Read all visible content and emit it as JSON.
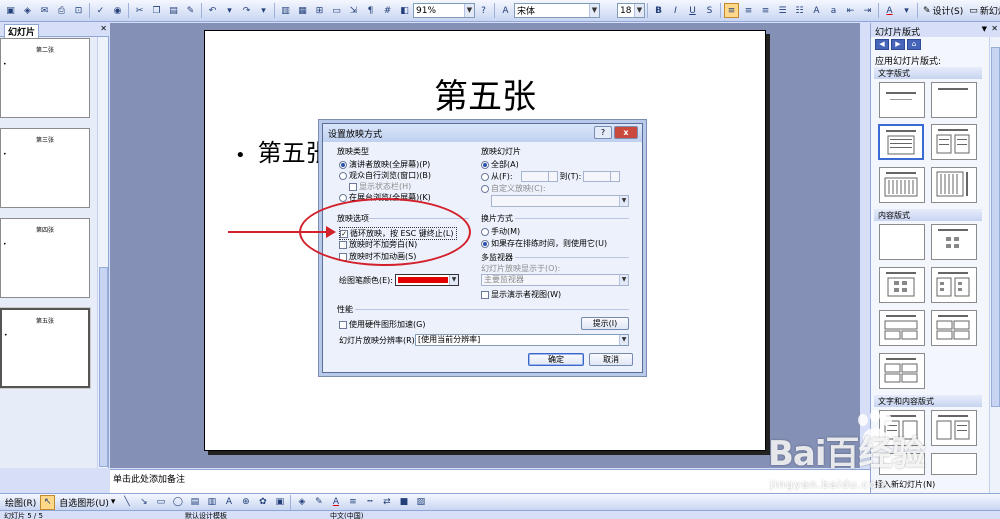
{
  "toolbar": {
    "zoom": "91%",
    "font_name": "宋体",
    "font_size": "18",
    "bold": "B",
    "italic": "I",
    "underline": "U",
    "shadow": "S",
    "font_color": "A",
    "design_label": "设计(S)",
    "new_slide_label": "新幻灯片(N)"
  },
  "slides_pane": {
    "tab_label": "幻灯片",
    "thumbnails": [
      {
        "title": "第二张",
        "bullet": "•"
      },
      {
        "title": "第三张",
        "bullet": "•"
      },
      {
        "title": "第四张",
        "bullet": "•"
      },
      {
        "title": "第五张",
        "bullet": "•"
      }
    ]
  },
  "slide": {
    "title": "第五张",
    "bullet": "•",
    "bullet_text": "第五张"
  },
  "dialog": {
    "title": "设置放映方式",
    "help": "?",
    "close": "x",
    "show_type": {
      "label": "放映类型",
      "options": [
        "演讲者放映(全屏幕)(P)",
        "观众自行浏览(窗口)(B)",
        "在展台浏览(全屏幕)(K)"
      ],
      "sub_option": "显示状态栏(H)"
    },
    "show_slides": {
      "label": "放映幻灯片",
      "all": "全部(A)",
      "from": "从(F):",
      "to": "到(T):",
      "custom": "自定义放映(C):"
    },
    "show_options": {
      "label": "放映选项",
      "loop": "循环放映，按 ESC 键终止(L)",
      "no_narration": "放映时不加旁白(N)",
      "no_animation": "放映时不加动画(S)"
    },
    "advance": {
      "label": "换片方式",
      "manual": "手动(M)",
      "timings": "如果存在排练时间，则使用它(U)"
    },
    "multi_monitor": {
      "label": "多监视器",
      "display_on": "幻灯片放映显示于(O):",
      "monitor": "主要监视器",
      "presenter_view": "显示演示者视图(W)"
    },
    "pen_color_label": "绘图笔颜色(E):",
    "pen_color": "#e00000",
    "performance": {
      "label": "性能",
      "hardware_accel": "使用硬件图形加速(G)",
      "tips": "提示(I)",
      "resolution_label": "幻灯片放映分辨率(R):",
      "resolution_value": "[使用当前分辨率]"
    },
    "ok": "确定",
    "cancel": "取消"
  },
  "task_pane": {
    "title": "幻灯片版式",
    "apply_label": "应用幻灯片版式:",
    "section_text": "文字版式",
    "section_content": "内容版式",
    "section_text_content": "文字和内容版式",
    "bottom_text": "插入新幻灯片(N)"
  },
  "notes": {
    "placeholder": "单击此处添加备注"
  },
  "drawbar": {
    "draw_label": "绘图(R)",
    "autoshapes_label": "自选图形(U)"
  },
  "status": {
    "slide_info": "幻灯片 5 / 5",
    "design": "默认设计模板",
    "language": "中文(中国)"
  },
  "watermark": {
    "logo": "Bai百经验",
    "site": "jingyan.baidu.com"
  },
  "colors": {
    "annotation": "#d3202a",
    "dialog_bg": "#ecf1fb",
    "workspace": "#8490b6"
  }
}
